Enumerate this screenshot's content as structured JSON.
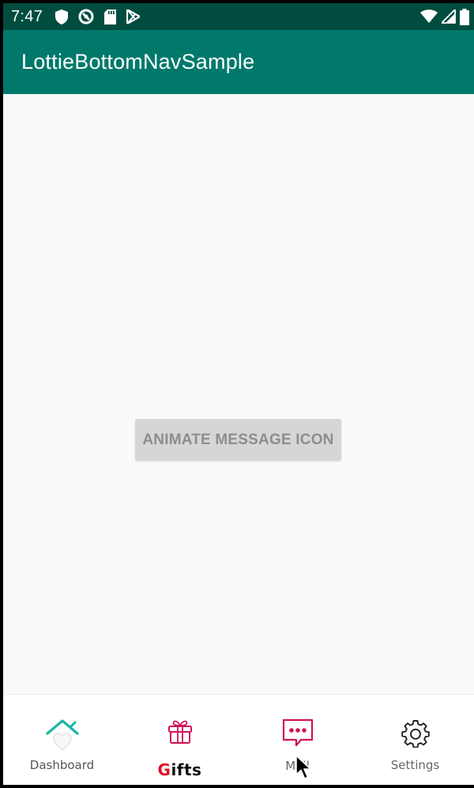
{
  "status_bar": {
    "time": "7:47",
    "left_icons": [
      "shield-icon",
      "vpn-icon",
      "sd-card-icon",
      "play-store-icon"
    ],
    "right_icons": [
      "wifi-icon",
      "signal-icon",
      "battery-icon"
    ],
    "background": "#004d40"
  },
  "app_bar": {
    "title": "LottieBottomNavSample",
    "background": "#00796b"
  },
  "main": {
    "animate_button_label": "ANIMATE MESSAGE ICON"
  },
  "bottom_nav": {
    "items": [
      {
        "label": "Dashboard",
        "icon": "home-heart-icon",
        "color": "#1ab6a6"
      },
      {
        "label_first": "G",
        "label_rest": "ifts",
        "icon": "gift-icon",
        "color": "#d0145a"
      },
      {
        "label": "Mail",
        "icon": "message-icon",
        "color": "#d0145a"
      },
      {
        "label": "Settings",
        "icon": "gear-icon",
        "color": "#222222"
      }
    ]
  }
}
